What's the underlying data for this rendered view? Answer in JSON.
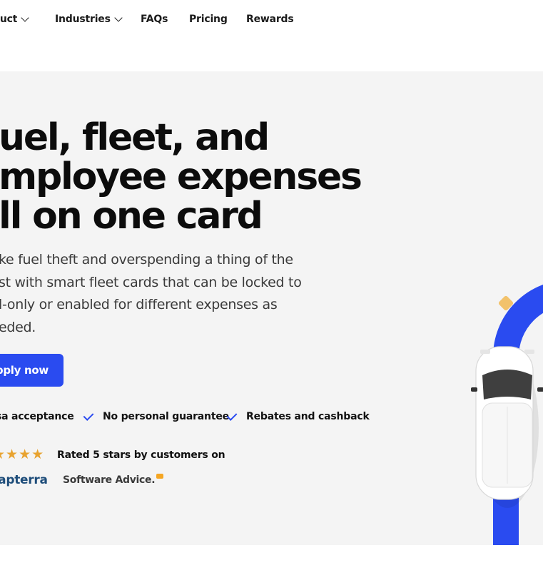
{
  "nav": {
    "items": [
      {
        "label": "duct",
        "has_dropdown": true
      },
      {
        "label": "Industries",
        "has_dropdown": true
      },
      {
        "label": "FAQs",
        "has_dropdown": false
      },
      {
        "label": "Pricing",
        "has_dropdown": false
      },
      {
        "label": "Rewards",
        "has_dropdown": false
      }
    ]
  },
  "hero": {
    "headline": [
      "uel, fleet, and",
      "mployee expenses",
      "ll on one card"
    ],
    "subtext": [
      "ke fuel theft and overspending a thing of the",
      "st with smart fleet cards that can be locked to",
      "l-only or enabled for different expenses as",
      "eded."
    ],
    "cta_label": "Apply now",
    "features": [
      "sa acceptance",
      "No personal guarantee",
      "Rebates and cashback"
    ],
    "rating_text": "Rated 5 stars by customers on",
    "rating_stars": 5,
    "review_sites": [
      "Capterra",
      "Software Advice."
    ]
  },
  "colors": {
    "accent": "#2a4bf0",
    "hero_bg": "#f4f4f4",
    "star": "#e8a330",
    "capterra": "#1e4d7a",
    "road": "#2a4bf0",
    "marker": "#f2c26b"
  },
  "icons": {
    "dropdown": "chevron-down-icon",
    "check": "check-icon",
    "star": "star-icon",
    "speech_bubble": "speech-bubble-icon"
  }
}
